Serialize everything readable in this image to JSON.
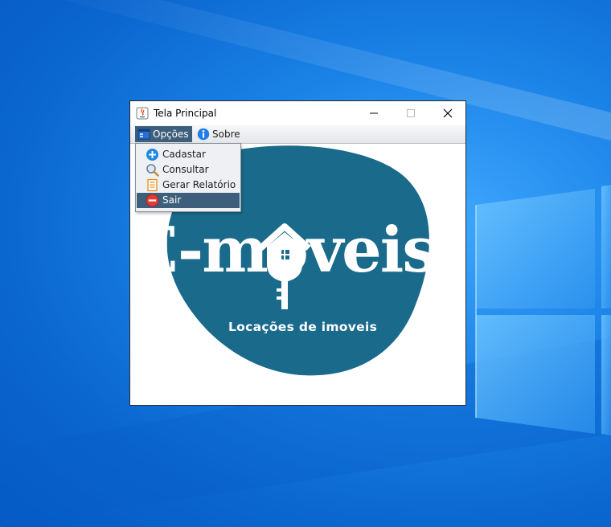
{
  "window": {
    "title": "Tela Principal",
    "app_icon": "java-icon"
  },
  "menubar": {
    "items": [
      {
        "label": "Opções",
        "icon": "window-icon",
        "active": true
      },
      {
        "label": "Sobre",
        "icon": "info-icon",
        "active": false
      }
    ]
  },
  "dropdown": {
    "items": [
      {
        "label": "Cadastar",
        "icon": "plus-circle-icon",
        "icon_color": "#1e88e5"
      },
      {
        "label": "Consultar",
        "icon": "magnifier-icon",
        "icon_color": "#6a7f96"
      },
      {
        "label": "Gerar Relatório",
        "icon": "report-icon",
        "icon_color": "#e08a20"
      },
      {
        "label": "Sair",
        "icon": "minus-circle-icon",
        "icon_color": "#e53935",
        "highlighted": true
      }
    ]
  },
  "logo": {
    "brand_name": "E-moveis",
    "tagline": "Locações de imoveis",
    "blob_color": "#1a6a8c",
    "text_color": "#ffffff"
  },
  "colors": {
    "menu_highlight": "#3d5f7c",
    "desktop": "#0b67d0"
  }
}
